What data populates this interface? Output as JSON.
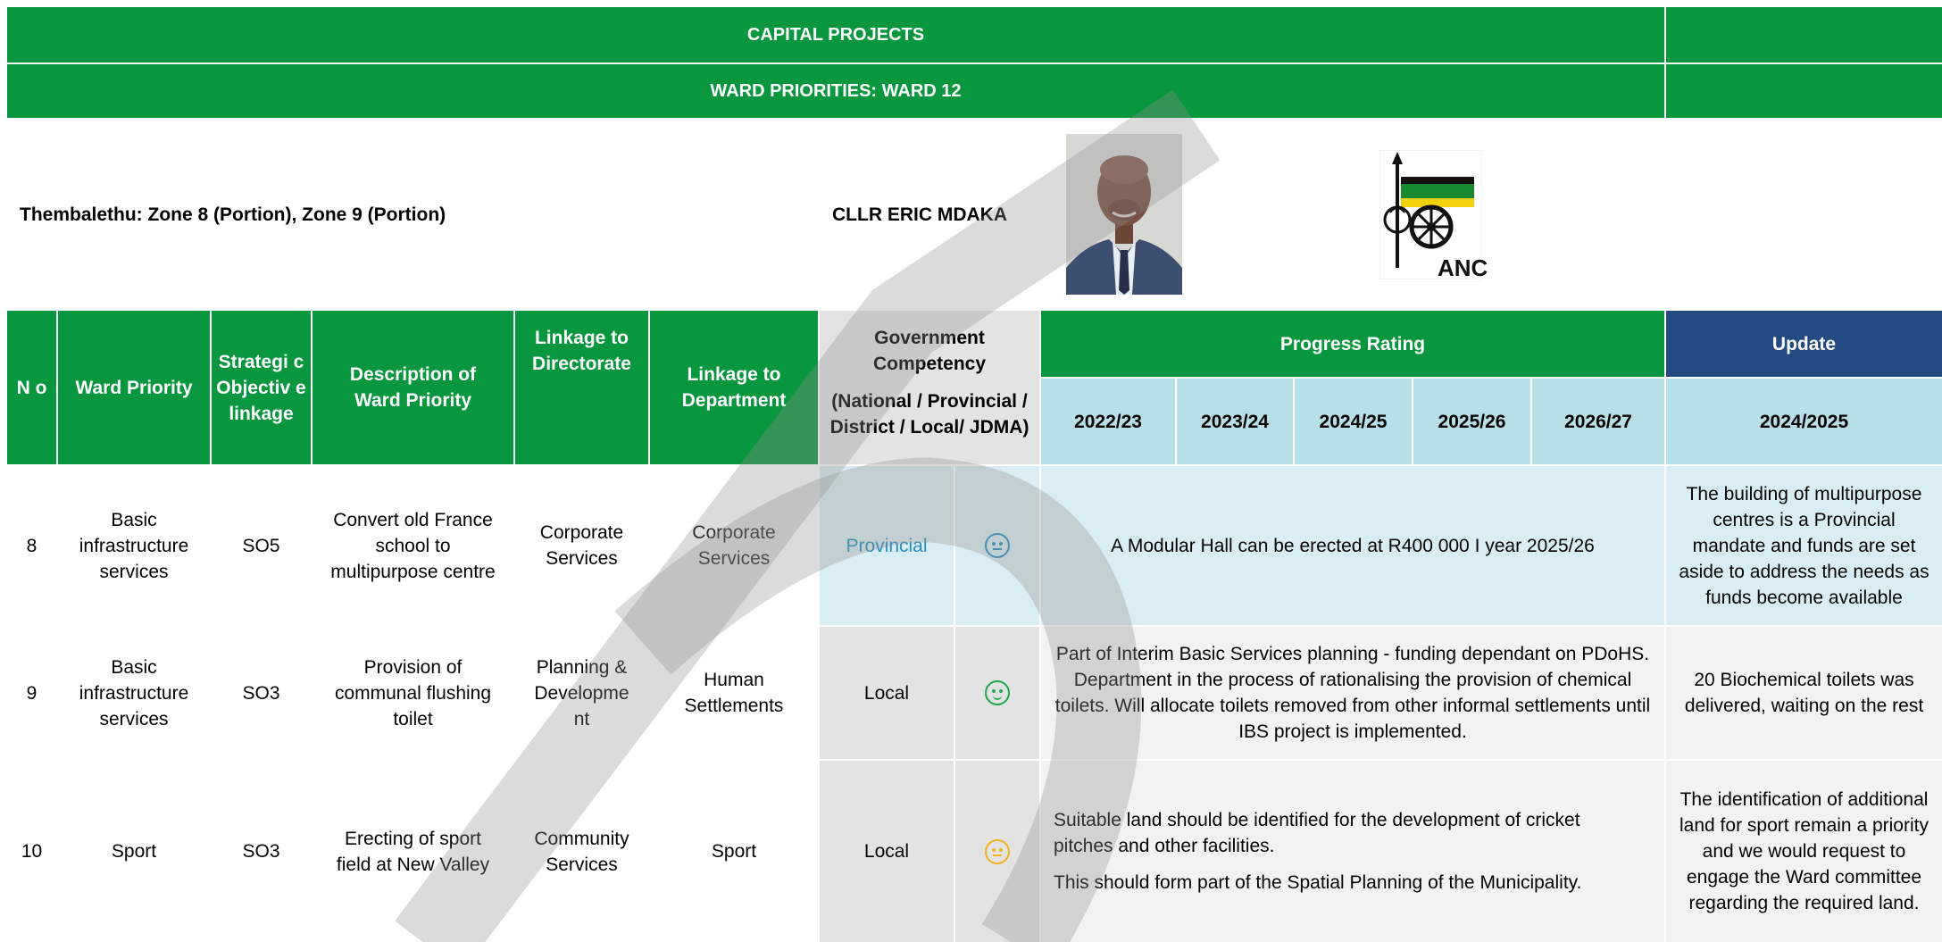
{
  "header": {
    "title": "CAPITAL PROJECTS",
    "subtitle": "WARD PRIORITIES: WARD 12"
  },
  "ward": {
    "area": "Thembalethu: Zone 8 (Portion), Zone 9 (Portion)",
    "councillor": "CLLR ERIC MDAKA",
    "party_logo_text": "ANC"
  },
  "columns": {
    "no": "N o",
    "ward_priority": "Ward Priority",
    "strategic": "Strategi c Objectiv e linkage",
    "description": "Description of Ward Priority",
    "directorate": "Linkage to Directorate",
    "department": "Linkage to Department",
    "gov_comp_title": "Government Competency",
    "gov_comp_sub": "(National / Provincial / District / Local/ JDMA)",
    "progress_rating": "Progress Rating",
    "update": "Update",
    "years": [
      "2022/23",
      "2023/24",
      "2024/25",
      "2025/26",
      "2026/27"
    ],
    "update_year": "2024/2025"
  },
  "rows": [
    {
      "no": "8",
      "priority": "Basic infrastructure services",
      "so": "SO5",
      "description": "Convert old France school to multipurpose centre",
      "directorate": "Corporate Services",
      "department": "Corporate Services",
      "competency": "Provincial",
      "rating": "neutral",
      "rating_color": "#2a8fc0",
      "progress": "A Modular Hall can be erected at R400 000 I year 2025/26",
      "update": "The building of multipurpose centres is a Provincial mandate and funds are set aside to address the needs as funds become available"
    },
    {
      "no": "9",
      "priority": "Basic infrastructure services",
      "so": "SO3",
      "description": "Provision of communal flushing toilet",
      "directorate": "Planning & Developme nt",
      "department": "Human Settlements",
      "competency": "Local",
      "rating": "happy",
      "rating_color": "#1fa84a",
      "progress": "Part of Interim Basic Services planning - funding dependant on PDoHS. Department in the process of rationalising the provision of chemical toilets. Will allocate toilets removed from other informal settlements until IBS project is implemented.",
      "update": "20 Biochemical toilets was delivered, waiting on the rest"
    },
    {
      "no": "10",
      "priority": "Sport",
      "so": "SO3",
      "description": "Erecting of sport field at New Valley",
      "directorate": "Community Services",
      "department": "Sport",
      "competency": "Local",
      "rating": "neutral",
      "rating_color": "#f2b21b",
      "progress_p1": "Suitable land should be identified for the development of cricket pitches and other facilities.",
      "progress_p2": "This should form part of the Spatial Planning of the Municipality.",
      "update": "The identification of additional land for sport remain a priority and we would request to engage the Ward committee regarding the required land."
    }
  ],
  "colors": {
    "green": "#08963f",
    "navy": "#234b82",
    "light_blue": "#b7dfe8",
    "pale_cyan": "#d9eef4",
    "grey": "#e3e3e3"
  }
}
